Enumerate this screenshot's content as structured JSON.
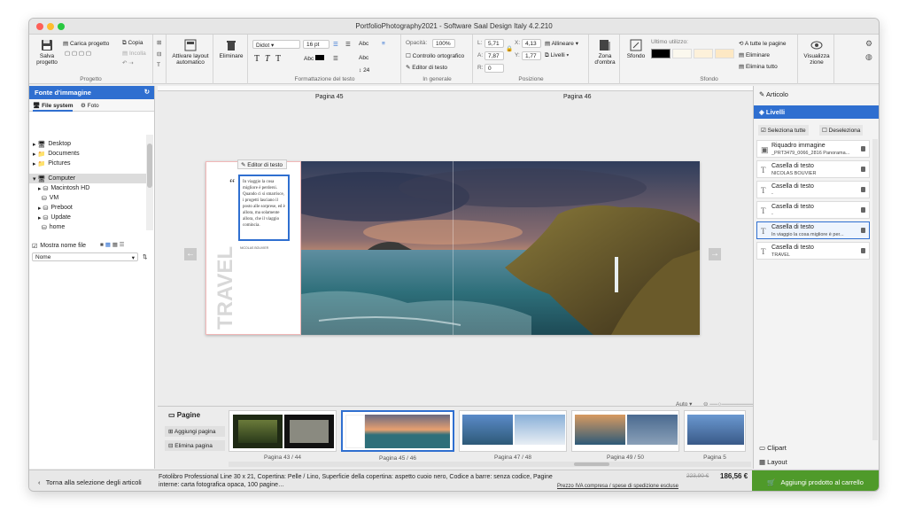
{
  "window": {
    "title": "PortfolioPhotography2021 - Software Saal Design Italy 4.2.210"
  },
  "ribbon": {
    "progetto": {
      "label": "Progetto",
      "save": "Salva progetto",
      "load": "Carica progetto",
      "copy": "Copia",
      "paste": "Incolla"
    },
    "layout": {
      "auto": "Attivare layout automatico"
    },
    "delete": "Eliminare",
    "text_format": {
      "label": "Formattazione del testo",
      "font": "Didot",
      "size": "16 pt",
      "leading": "24"
    },
    "general": {
      "label": "In generale",
      "opacity_label": "Opacità:",
      "opacity": "100%",
      "spellcheck": "Controllo ortografico",
      "text_editor": "Editor di testo"
    },
    "position": {
      "label": "Posizione",
      "l_label": "L:",
      "l": "5,71",
      "a_label": "A:",
      "a": "7,87",
      "r_label": "R:",
      "r": "0",
      "x_label": "X:",
      "x": "4,13",
      "y_label": "Y:",
      "y": "1,77",
      "align": "Allineare",
      "levels": "Livelli"
    },
    "shadow": {
      "label": "Zona d'ombra"
    },
    "background": {
      "label": "Sfondo",
      "btn": "Sfondo",
      "last_used": "Ultimo utilizzo:",
      "apply_all": "A tutte le pagine",
      "delete": "Eliminare",
      "delete_all": "Elimina tutto",
      "colors": [
        "#000000",
        "#fbf8ee",
        "#fdf1da",
        "#fde8c4"
      ]
    },
    "view": {
      "label": "Visualizza zione"
    }
  },
  "left_panel": {
    "title": "Fonte d'immagine",
    "tab_fs": "File system",
    "tab_photo": "Foto",
    "tree": [
      "Desktop",
      "Documents",
      "Pictures"
    ],
    "computer": "Computer",
    "drives": [
      "Macintosh HD",
      "VM",
      "Preboot",
      "Update",
      "home"
    ],
    "show_names": "Mostra nome file",
    "sort": "Nome"
  },
  "canvas": {
    "page_left": "Pagina 45",
    "page_right": "Pagina 46",
    "editor_tip": "Editor di testo",
    "quote": "In viaggio la cosa migliore è perdersi. Quando ci si smarrisce, i progetti lasciano il posto alle sorprese, ed è allora, ma solamente allora, che il viaggio comincia.",
    "author": "NICOLAS BOUVIER",
    "travel": "TRAVEL",
    "zoom": "Auto",
    "colors": {
      "sky_top": "#3c4c6c",
      "sunset": "#e8a070",
      "sea": "#2e6f7a",
      "cliff": "#6a5a2a"
    }
  },
  "pages_panel": {
    "title": "Pagine",
    "add": "Aggiungi pagina",
    "remove": "Elimina pagina",
    "thumbs": [
      "Pagina 43 / 44",
      "Pagina 45 / 46",
      "Pagina 47 / 48",
      "Pagina 49 / 50",
      "Pagina 5"
    ]
  },
  "right_panel": {
    "article": "Articolo",
    "levels": "Livelli",
    "select_all": "Seleziona tutte",
    "deselect": "Deseleziona",
    "layers": [
      {
        "type": "Riquadro immagine",
        "detail": "_PRT3479_0066_2816 Panorama..."
      },
      {
        "type": "Casella di testo",
        "detail": "NICOLAS BOUVIER"
      },
      {
        "type": "Casella di testo",
        "detail": "-"
      },
      {
        "type": "Casella di testo",
        "detail": "-"
      },
      {
        "type": "Casella di testo",
        "detail": "In viaggio la cosa migliore è per..."
      },
      {
        "type": "Casella di testo",
        "detail": "TRAVEL"
      }
    ],
    "clipart": "Clipart",
    "layout": "Layout"
  },
  "status": {
    "back": "Torna alla selezione degli articoli",
    "product": "Fotolibro Professional Line 30 x 21, Copertina: Pelle / Lino, Superficie della copertina: aspetto cuoio nero, Codice a barre: senza codice, Pagine interne: carta fotografica opaca, 100 pagine…",
    "price_note": "Prezzo IVA compresa / spese di spedizione escluse",
    "old_price": "223,90 €",
    "price": "186,56 €",
    "cart": "Aggiungi prodotto al carrello"
  }
}
